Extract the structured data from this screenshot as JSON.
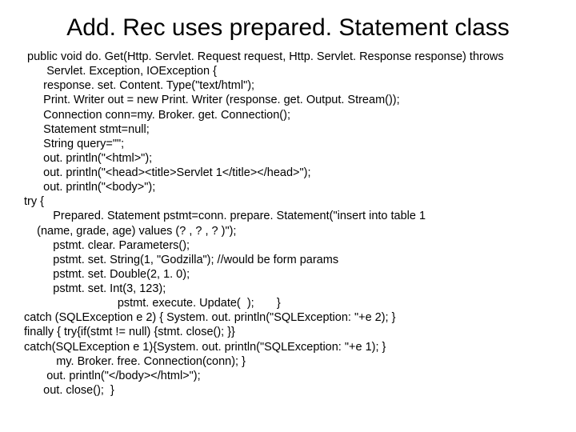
{
  "title": "Add. Rec uses prepared. Statement class",
  "lines": [
    " public void do. Get(Http. Servlet. Request request, Http. Servlet. Response response) throws",
    "       Servlet. Exception, IOException {",
    "      response. set. Content. Type(\"text/html\");",
    "      Print. Writer out = new Print. Writer (response. get. Output. Stream());",
    "      Connection conn=my. Broker. get. Connection();",
    "      Statement stmt=null;",
    "      String query=\"\";",
    "      out. println(\"<html>\");",
    "      out. println(\"<head><title>Servlet 1</title></head>\");",
    "      out. println(\"<body>\");",
    "try {",
    "         Prepared. Statement pstmt=conn. prepare. Statement(\"insert into table 1",
    "    (name, grade, age) values (? , ? , ? )\");",
    "         pstmt. clear. Parameters();",
    "         pstmt. set. String(1, \"Godzilla\"); //would be form params",
    "         pstmt. set. Double(2, 1. 0);",
    "         pstmt. set. Int(3, 123);",
    "                             pstmt. execute. Update(  );       }",
    "catch (SQLException e 2) { System. out. println(\"SQLException: \"+e 2); }",
    "finally { try{if(stmt != null) {stmt. close(); }}",
    "catch(SQLException e 1){System. out. println(\"SQLException: \"+e 1); }",
    "          my. Broker. free. Connection(conn); }",
    "       out. println(\"</body></html>\");",
    "      out. close();  }"
  ]
}
